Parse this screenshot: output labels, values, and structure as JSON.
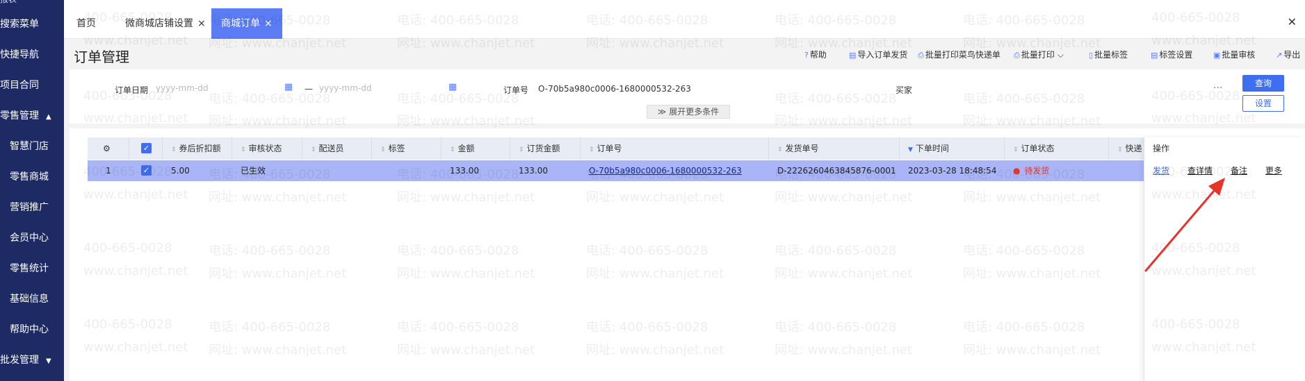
{
  "sidebar": {
    "top_partial": "报表",
    "items": [
      {
        "label": "搜索菜单"
      },
      {
        "label": "快捷导航"
      },
      {
        "label": "项目合同"
      },
      {
        "label": "零售管理"
      },
      {
        "label": "智慧门店"
      },
      {
        "label": "零售商城"
      },
      {
        "label": "营销推广"
      },
      {
        "label": "会员中心"
      },
      {
        "label": "零售统计"
      },
      {
        "label": "基础信息"
      },
      {
        "label": "帮助中心"
      },
      {
        "label": "批发管理"
      }
    ]
  },
  "tabs": [
    {
      "label": "首页"
    },
    {
      "label": "微商城店铺设置"
    },
    {
      "label": "商城订单"
    }
  ],
  "page": {
    "title": "订单管理"
  },
  "toolbar": {
    "help": "帮助",
    "import_ship": "导入订单发货",
    "batch_print_cainiao": "批量打印菜鸟快递单",
    "batch_print": "批量打印",
    "batch_tag": "批量标签",
    "tag_settings": "标签设置",
    "batch_review": "批量审核",
    "export": "导出"
  },
  "filter": {
    "order_date_label": "订单日期",
    "date_start_placeholder": "yyyy-mm-dd",
    "date_sep": "—",
    "date_end_placeholder": "yyyy-mm-dd",
    "order_no_label": "订单号",
    "order_no_value": "O-70b5a980c0006-1680000532-263",
    "buyer_label": "买家",
    "more_dots": "···",
    "query_button": "查询",
    "setting_button": "设置",
    "expand_label": "展开更多条件"
  },
  "table": {
    "columns": [
      "券后折扣额",
      "审核状态",
      "配送员",
      "标签",
      "金额",
      "订货金额",
      "订单号",
      "发货单号",
      "下单时间",
      "订单状态",
      "快递"
    ],
    "operation_header": "操作",
    "rows": [
      {
        "index": "1",
        "discount": "5.00",
        "review_status": "已生效",
        "courier": "",
        "tag": "",
        "amount": "133.00",
        "order_amount": "133.00",
        "order_no": "O-70b5a980c0006-1680000532-263",
        "ship_no": "D-2226260463845876-0001",
        "order_time": "2023-03-28 18:48:54",
        "order_status": "待发货",
        "ops": [
          "发货",
          "查详情",
          "备注",
          "更多"
        ]
      }
    ]
  },
  "watermark": {
    "phone": "电话: 400-665-0028",
    "site": "网址: www.chanjet.net",
    "phone_short": "400-665-0028",
    "site_short": "www.chanjet.net"
  },
  "colors": {
    "sidebar_bg": "#1d2a64",
    "active_tab": "#5b7cf5",
    "primary": "#3f6ef0",
    "selected_row": "#a9b5f7",
    "status_red": "#e63a2e"
  }
}
